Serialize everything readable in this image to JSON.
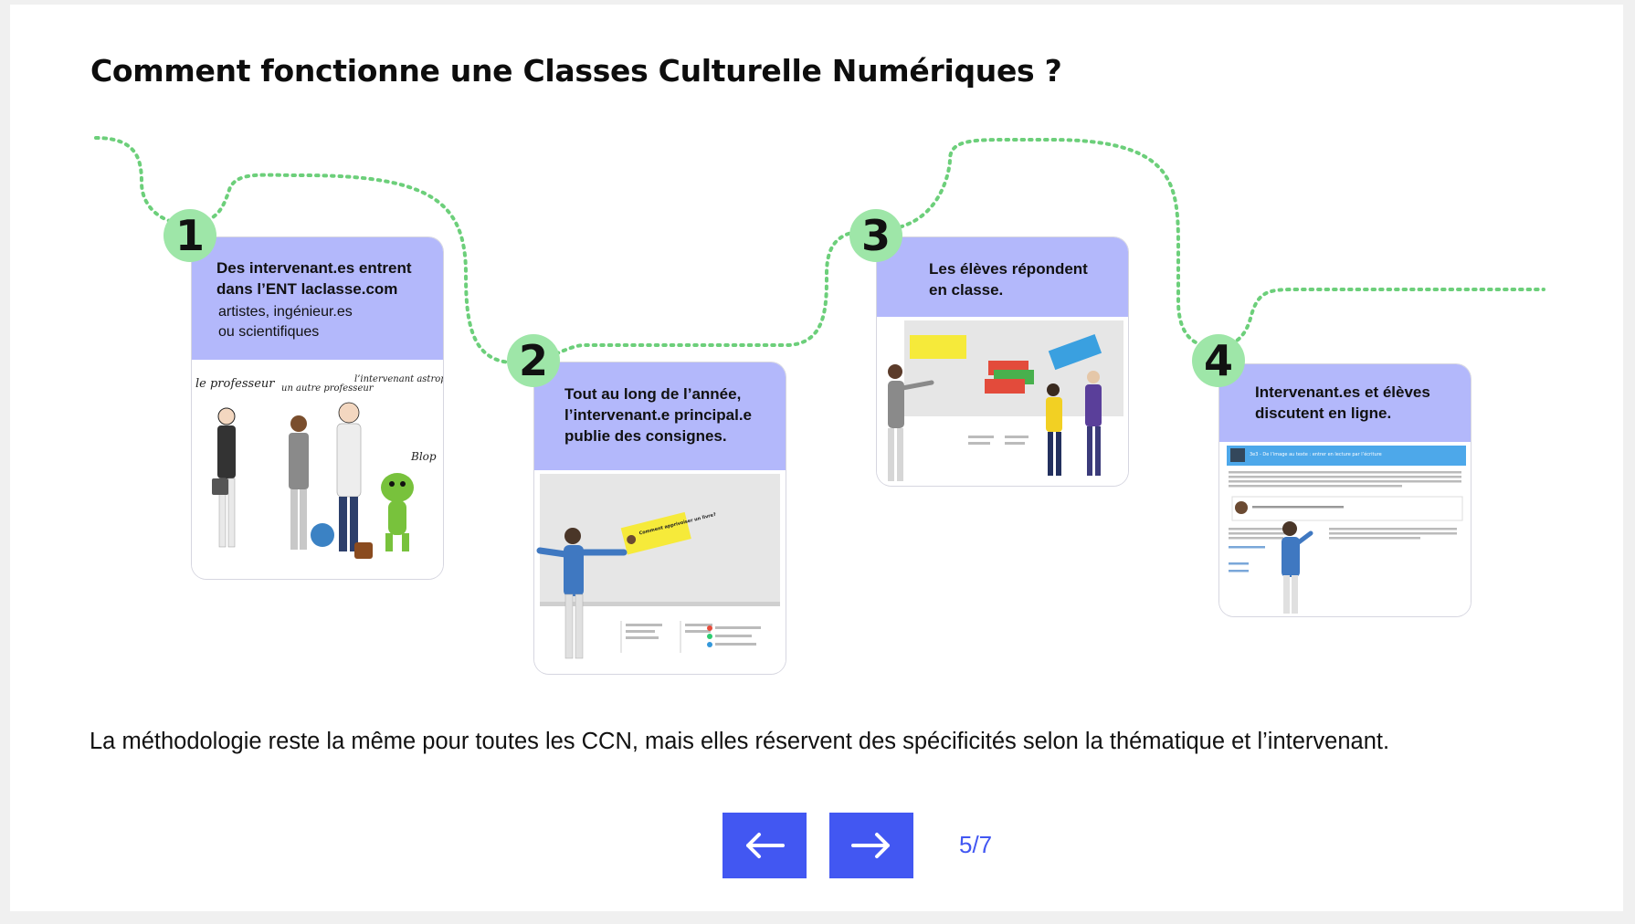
{
  "page": {
    "title": "Comment fonctionne une Classes Culturelle Numériques ?",
    "caption": "La méthodologie reste la même pour toutes les CCN, mais elles réservent des spécificités selon la thématique et l’intervenant.",
    "pager": "5/7"
  },
  "colors": {
    "accent": "#4257f2",
    "card_header": "#b3b8fb",
    "step_badge": "#9ee6a8",
    "path_dots": "#6ccf7a"
  },
  "steps": [
    {
      "number": "1",
      "title_lines": [
        "Des intervenant.es entrent",
        "dans l’ENT laclasse.com"
      ],
      "subtitle_lines": [
        "artistes, ingénieur.es",
        "ou scientifiques"
      ],
      "illustration": {
        "labels": [
          "le professeur",
          "un autre professeur",
          "l’intervenant astrophysicien",
          "Blop"
        ]
      }
    },
    {
      "number": "2",
      "title_lines": [
        "Tout au long de l’année,",
        "l’intervenant.e principal.e",
        "publie des consignes."
      ],
      "illustration": {
        "note_text": "Comment apprivoiser un livre?"
      }
    },
    {
      "number": "3",
      "title_lines": [
        "Les élèves répondent",
        "en classe."
      ]
    },
    {
      "number": "4",
      "title_lines": [
        "Intervenant.es et élèves",
        "discutent en ligne."
      ],
      "illustration": {
        "post_title": "3e3 - De l’image au texte : entrer en lecture par l’écriture"
      }
    }
  ],
  "navigation": {
    "prev_icon": "arrow-left-icon",
    "next_icon": "arrow-right-icon"
  }
}
